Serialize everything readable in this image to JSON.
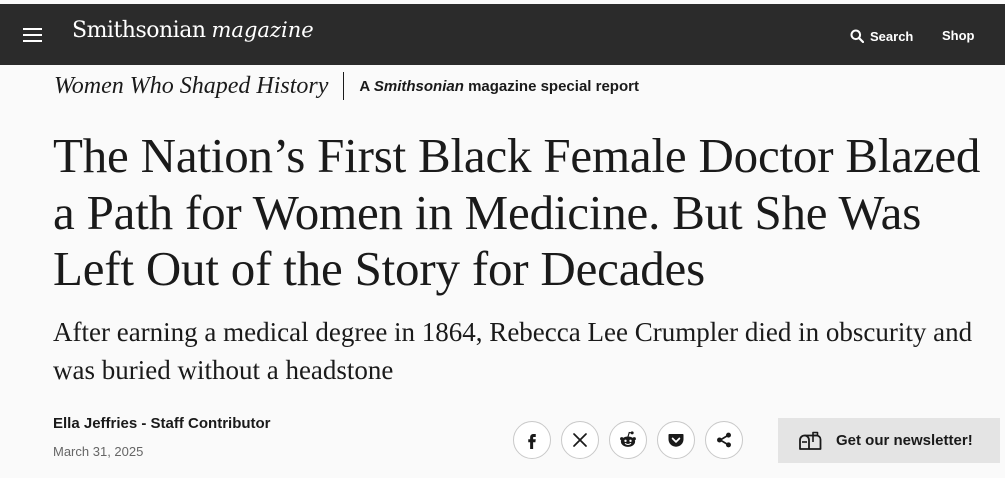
{
  "header": {
    "brand": "Smithsonian",
    "brand_suffix": "magazine",
    "search_label": "Search",
    "shop_label": "Shop",
    "menu_icon": "hamburger-menu-icon",
    "search_icon": "search-icon"
  },
  "kicker": {
    "series": "Women Who Shaped History",
    "report_prefix": "A",
    "report_brand": "Smithsonian",
    "report_suffix": "magazine special report"
  },
  "article": {
    "headline": "The Nation’s First Black Female Doctor Blazed a Path for Women in Medicine. But She Was Left Out of the Story for Decades",
    "dek": "After earning a medical degree in 1864, Rebecca Lee Crumpler died in obscurity and was buried without a headstone",
    "byline": "Ella Jeffries - Staff Contributor",
    "date": "March 31, 2025"
  },
  "share": {
    "icons": [
      "facebook-icon",
      "x-icon",
      "reddit-icon",
      "pocket-icon",
      "share-icon"
    ]
  },
  "newsletter": {
    "label": "Get our newsletter!",
    "icon": "mailbox-icon"
  },
  "colors": {
    "navbar": "#2b2b2b",
    "page": "#fafafa",
    "newsletter_bg": "#e4e4e4"
  }
}
